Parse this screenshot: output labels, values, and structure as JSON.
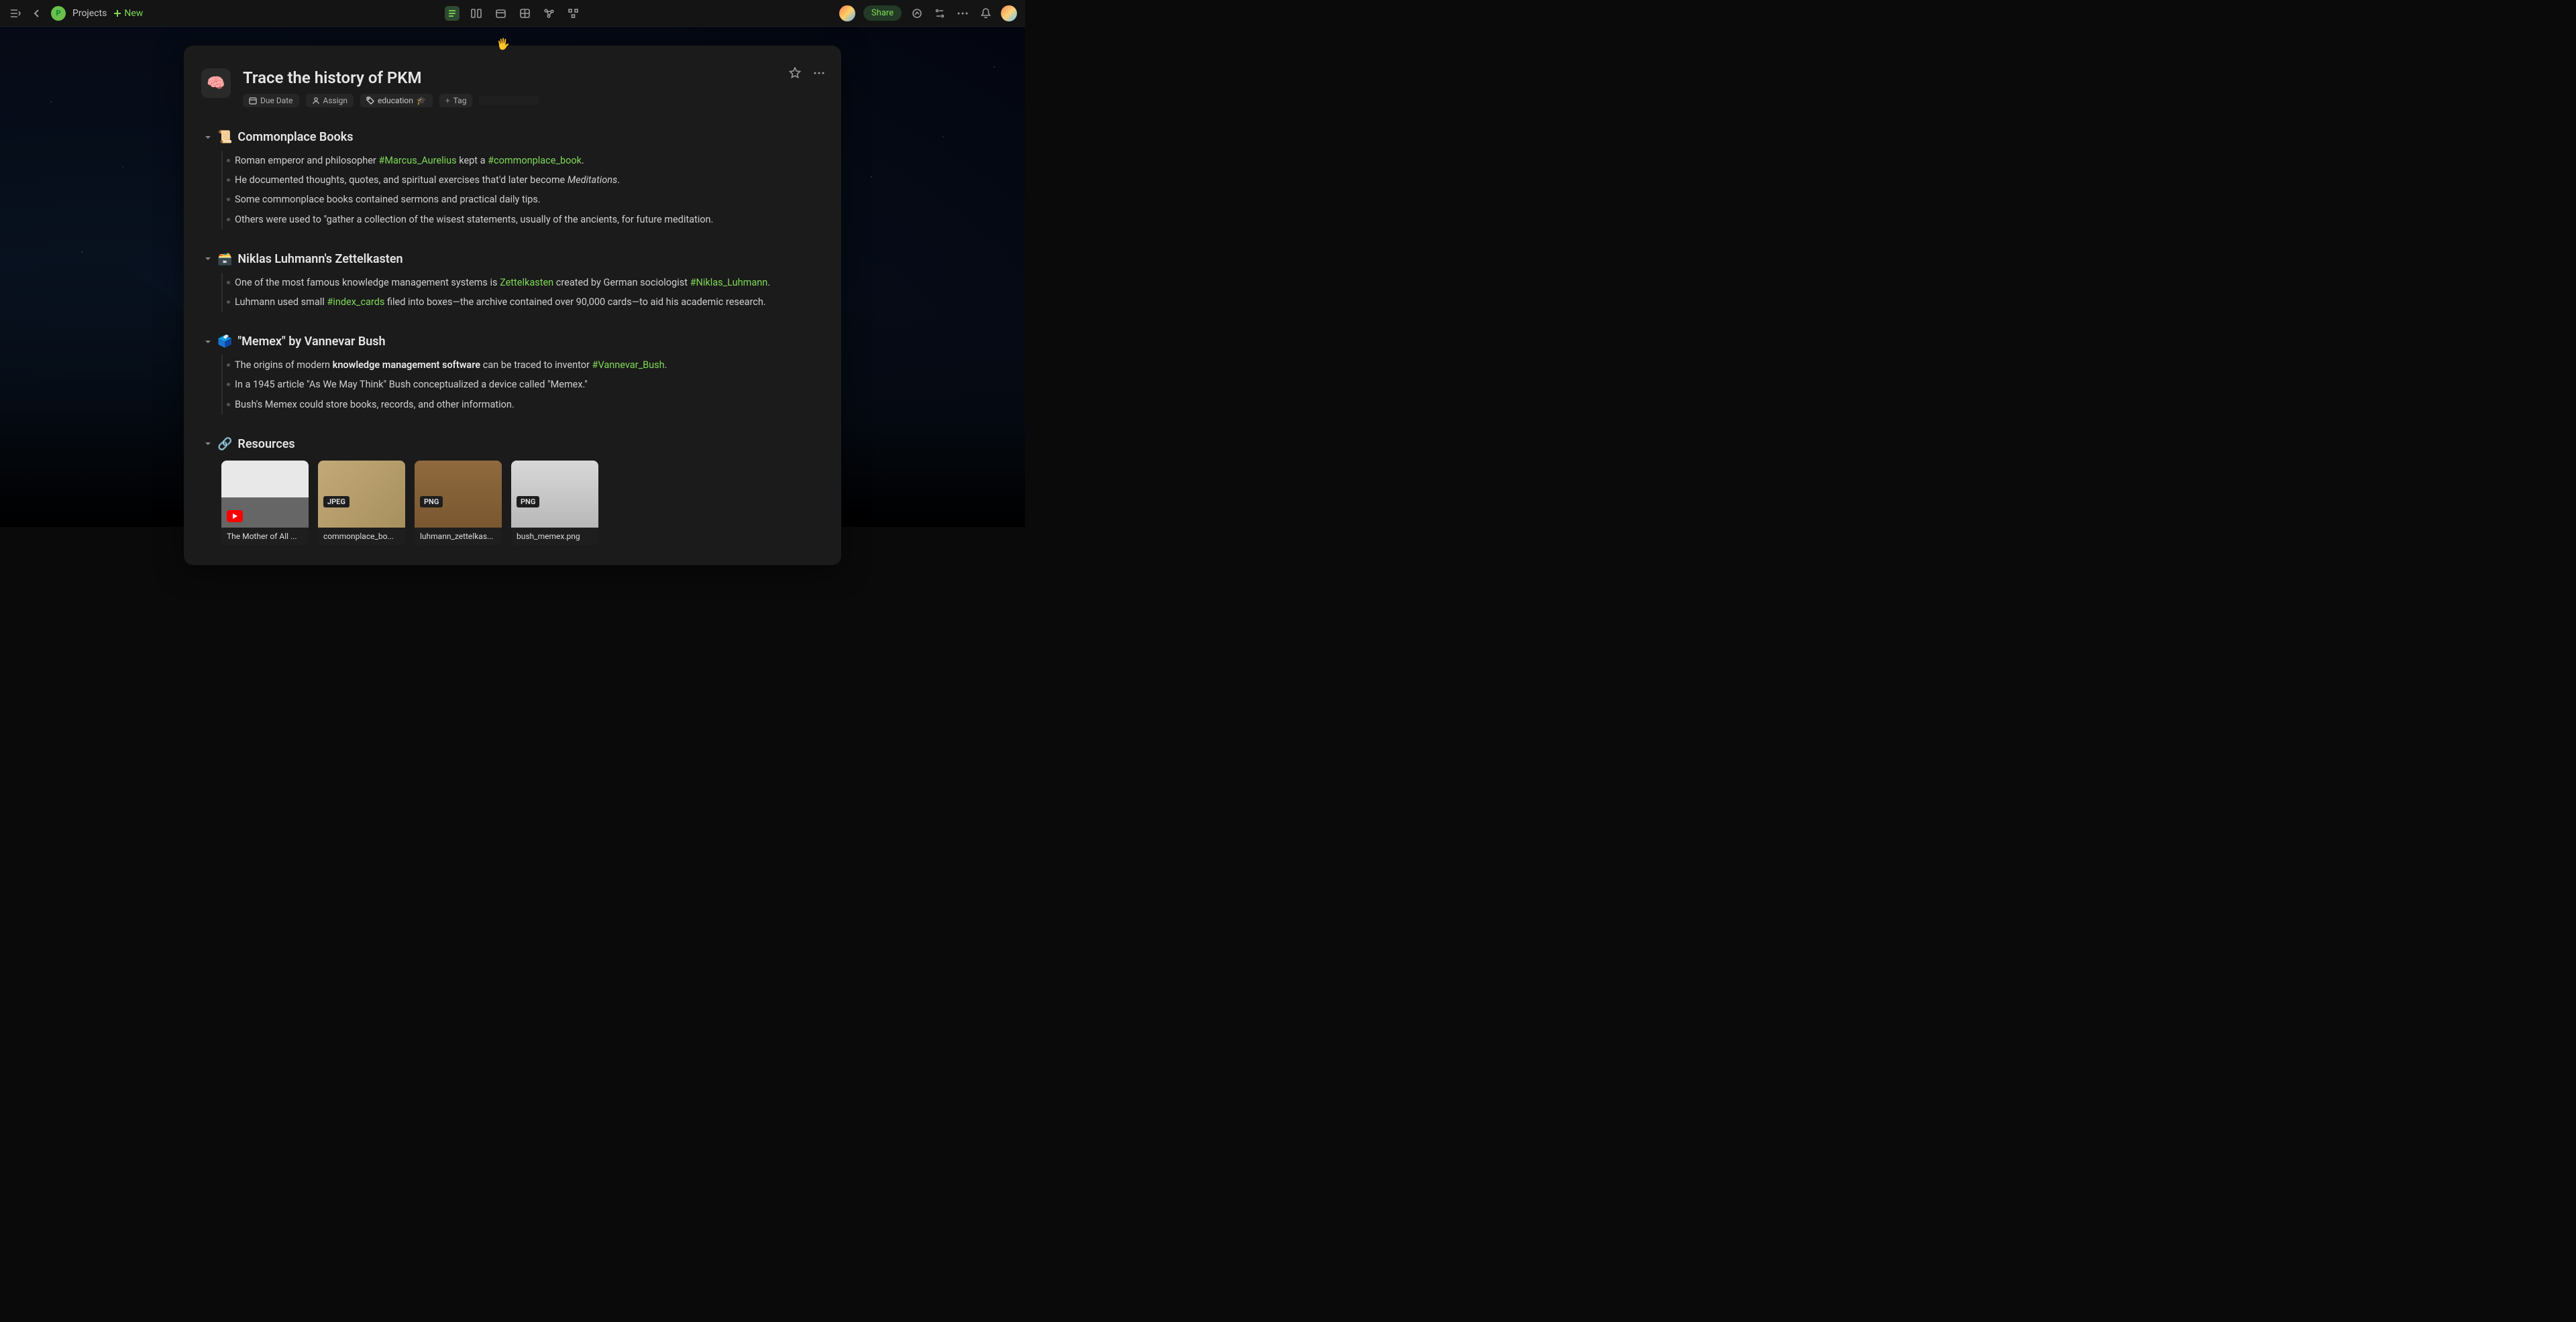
{
  "topbar": {
    "workspace_initial": "P",
    "breadcrumb": "Projects",
    "new_label": "New",
    "share_label": "Share"
  },
  "doc": {
    "emoji": "🧠",
    "title": "Trace the history of PKM",
    "meta": {
      "due_date": "Due Date",
      "assign": "Assign",
      "tag_value": "education",
      "tag_emoji": "🎓",
      "add_tag": "Tag"
    }
  },
  "sections": [
    {
      "emoji": "📜",
      "title": "Commonplace Books",
      "bullets": [
        {
          "parts": [
            {
              "t": "Roman emperor and philosopher "
            },
            {
              "t": "#Marcus_Aurelius",
              "c": "green"
            },
            {
              "t": " kept a "
            },
            {
              "t": "#commonplace_book",
              "c": "green"
            },
            {
              "t": "."
            }
          ]
        },
        {
          "parts": [
            {
              "t": "He documented thoughts, quotes, and spiritual exercises that'd later become "
            },
            {
              "t": "Meditations",
              "c": "ital"
            },
            {
              "t": "."
            }
          ]
        },
        {
          "parts": [
            {
              "t": "Some commonplace books contained sermons and practical daily tips."
            }
          ]
        },
        {
          "parts": [
            {
              "t": "Others were used to \"gather a collection of the wisest statements, usually of the ancients, for future meditation."
            }
          ]
        }
      ]
    },
    {
      "emoji": "🗃️",
      "title": "Niklas Luhmann's Zettelkasten",
      "bullets": [
        {
          "parts": [
            {
              "t": "One of the most famous knowledge management systems is "
            },
            {
              "t": "Zettelkasten",
              "c": "green"
            },
            {
              "t": " created by German sociologist "
            },
            {
              "t": "#Niklas_Luhmann",
              "c": "green"
            },
            {
              "t": "."
            }
          ]
        },
        {
          "parts": [
            {
              "t": "Luhmann used small "
            },
            {
              "t": "#index_cards",
              "c": "green"
            },
            {
              "t": " filed into boxes—the archive contained over 90,000 cards—to aid his academic research."
            }
          ]
        }
      ]
    },
    {
      "emoji": "🗳️",
      "title": "\"Memex\" by Vannevar Bush",
      "bullets": [
        {
          "parts": [
            {
              "t": "The origins of modern "
            },
            {
              "t": "knowledge management software",
              "c": "bold"
            },
            {
              "t": " can be traced to inventor "
            },
            {
              "t": "#Vannevar_Bush",
              "c": "green"
            },
            {
              "t": "."
            }
          ]
        },
        {
          "parts": [
            {
              "t": "In a 1945 article \"As We May Think\" Bush conceptualized a device called \"Memex.\""
            }
          ]
        },
        {
          "parts": [
            {
              "t": "Bush's Memex could store books, records, and other information."
            }
          ]
        }
      ]
    }
  ],
  "resources": {
    "emoji": "🔗",
    "title": "Resources",
    "items": [
      {
        "kind": "video",
        "label": "The Mother of All ...",
        "thumb": "video"
      },
      {
        "kind": "JPEG",
        "label": "commonplace_bo...",
        "thumb": "paper"
      },
      {
        "kind": "PNG",
        "label": "luhmann_zettelkas...",
        "thumb": "drawers"
      },
      {
        "kind": "PNG",
        "label": "bush_memex.png",
        "thumb": "memex"
      }
    ]
  }
}
